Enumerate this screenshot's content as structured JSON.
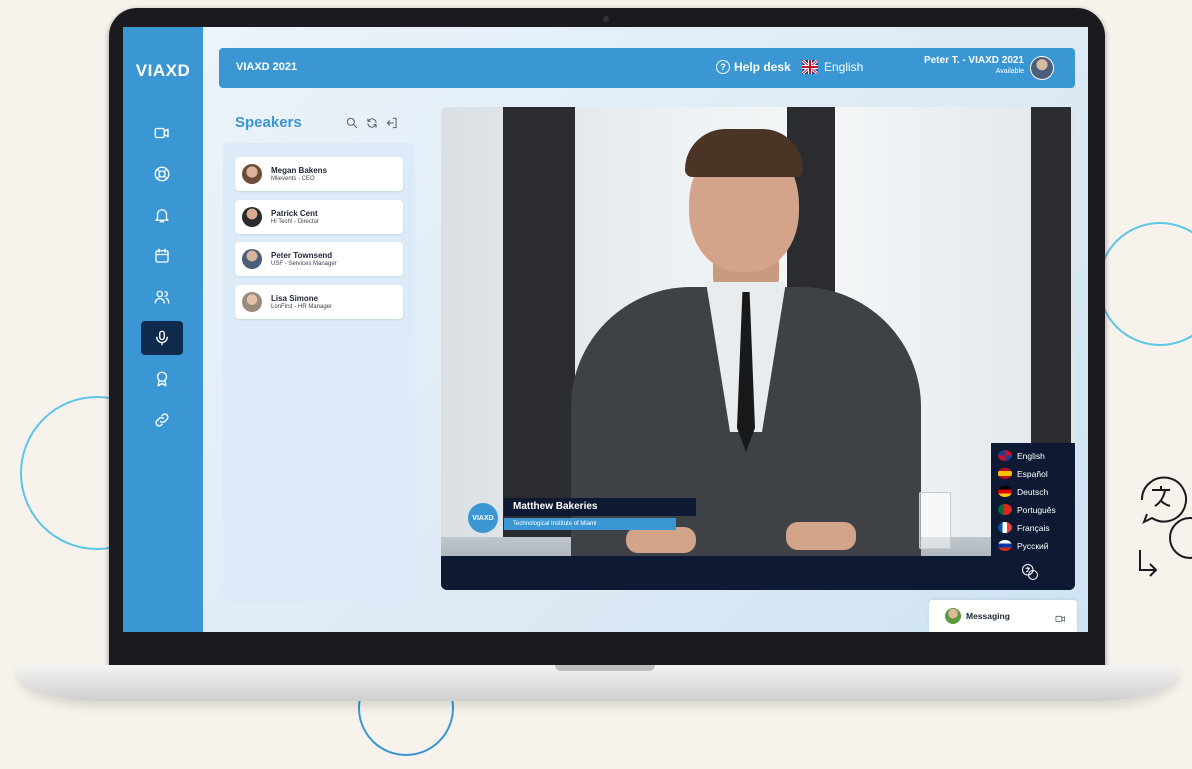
{
  "app": {
    "brand": "VIAXD",
    "event_title": "VIAXD 2021"
  },
  "header": {
    "help_label": "Help desk",
    "language_label": "English",
    "user_name": "Peter T. - VIAXD 2021",
    "user_status": "Available"
  },
  "sidebar": {
    "items": [
      {
        "name": "video-icon",
        "active": false
      },
      {
        "name": "lifebuoy-icon",
        "active": false
      },
      {
        "name": "bell-icon",
        "active": false
      },
      {
        "name": "calendar-icon",
        "active": false
      },
      {
        "name": "users-icon",
        "active": false
      },
      {
        "name": "microphone-icon",
        "active": true
      },
      {
        "name": "award-icon",
        "active": false
      },
      {
        "name": "link-icon",
        "active": false
      }
    ]
  },
  "speakers": {
    "title": "Speakers",
    "items": [
      {
        "name": "Megan Bakens",
        "role": "Mlievents - CEO"
      },
      {
        "name": "Patrick Cent",
        "role": "Hi Tech! - Director"
      },
      {
        "name": "Peter Townsend",
        "role": "USF - Services Manager"
      },
      {
        "name": "Lisa Simone",
        "role": "LonFirst - HR Manager"
      }
    ]
  },
  "video": {
    "logo_text": "VIAXD",
    "presenter_name": "Matthew Bakeries",
    "presenter_org": "Technological Institute of Miami",
    "languages": [
      "English",
      "Español",
      "Deutsch",
      "Português",
      "Français",
      "Русский"
    ]
  },
  "messaging": {
    "label": "Messaging"
  },
  "colors": {
    "accent": "#3a97d4",
    "dark": "#0e1a33",
    "active_nav": "#0e2a4c"
  }
}
